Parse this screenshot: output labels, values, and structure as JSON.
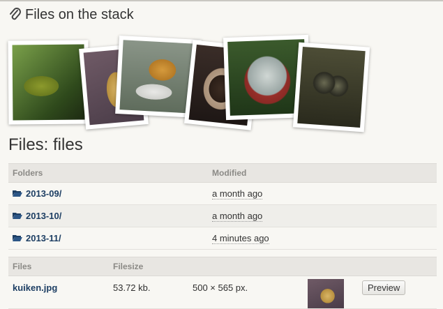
{
  "stack": {
    "title": "Files on the stack",
    "icon": "paperclip-icon"
  },
  "files_heading": "Files: files",
  "folders_table": {
    "headers": {
      "name": "Folders",
      "modified": "Modified"
    },
    "rows": [
      {
        "name": "2013-09/",
        "modified": "a month ago"
      },
      {
        "name": "2013-10/",
        "modified": "a month ago"
      },
      {
        "name": "2013-11/",
        "modified": "4 minutes ago"
      }
    ]
  },
  "files_table": {
    "headers": {
      "name": "Files",
      "size": "Filesize"
    },
    "rows": [
      {
        "name": "kuiken.jpg",
        "size": "53.72 kb.",
        "dimensions": "500 × 565 px.",
        "action": "Preview"
      }
    ]
  },
  "colors": {
    "link": "#1d3e63",
    "header_bg": "#e8e6e2",
    "page_bg": "#f8f7f3"
  }
}
